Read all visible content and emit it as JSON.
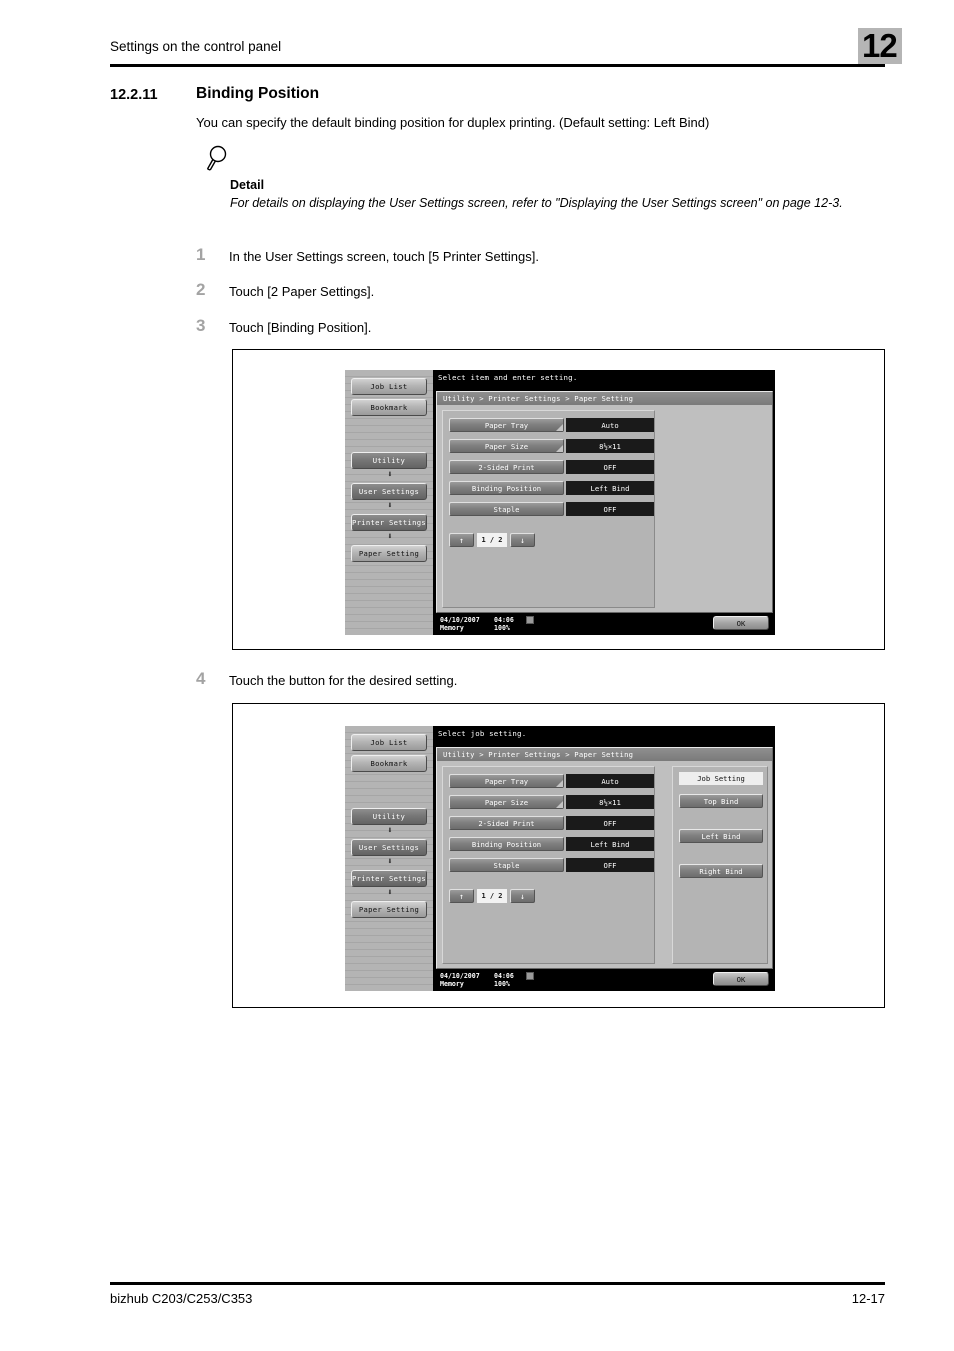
{
  "header": {
    "running_title": "Settings on the control panel",
    "chapter_number": "12"
  },
  "section": {
    "number": "12.2.11",
    "title": "Binding Position",
    "intro": "You can specify the default binding position for duplex printing. (Default setting: Left Bind)"
  },
  "detail": {
    "icon": "magnifier-icon",
    "label": "Detail",
    "text": "For details on displaying the User Settings screen, refer to \"Displaying the User Settings screen\" on page 12-3."
  },
  "steps": [
    {
      "number": "1",
      "text": "In the User Settings screen, touch [5 Printer Settings]."
    },
    {
      "number": "2",
      "text": "Touch [2 Paper Settings]."
    },
    {
      "number": "3",
      "text": "Touch [Binding Position]."
    },
    {
      "number": "4",
      "text": "Touch the button for the desired setting."
    }
  ],
  "figure1": {
    "message": "Select item and enter setting.",
    "breadcrumb": "Utility > Printer Settings > Paper Setting",
    "side_buttons": [
      {
        "label": "Job List",
        "style": "light"
      },
      {
        "label": "Bookmark",
        "style": "light"
      },
      {
        "label": "Utility",
        "style": "dark"
      },
      {
        "label": "User Settings",
        "style": "dark"
      },
      {
        "label": "Printer Settings",
        "style": "dark"
      },
      {
        "label": "Paper Setting",
        "style": "light"
      }
    ],
    "settings": [
      {
        "name": "Paper Tray",
        "value": "Auto",
        "has_corner": true
      },
      {
        "name": "Paper Size",
        "value": "8½×11",
        "has_corner": true
      },
      {
        "name": "2-Sided Print",
        "value": "OFF",
        "has_corner": false
      },
      {
        "name": "Binding Position",
        "value": "Left Bind",
        "has_corner": false
      },
      {
        "name": "Staple",
        "value": "OFF",
        "has_corner": false
      }
    ],
    "pager": {
      "up": "↑",
      "label": "1 / 2",
      "down": "↓"
    },
    "status": {
      "date": "04/10/2007",
      "time": "04:06",
      "memory_label": "Memory",
      "memory_value": "100%",
      "icon": "status-indicator-icon"
    },
    "ok_label": "OK"
  },
  "figure2": {
    "message": "Select job setting.",
    "breadcrumb": "Utility > Printer Settings > Paper Setting",
    "side_buttons": [
      {
        "label": "Job List",
        "style": "light"
      },
      {
        "label": "Bookmark",
        "style": "light"
      },
      {
        "label": "Utility",
        "style": "dark"
      },
      {
        "label": "User Settings",
        "style": "dark"
      },
      {
        "label": "Printer Settings",
        "style": "dark"
      },
      {
        "label": "Paper Setting",
        "style": "light"
      }
    ],
    "settings": [
      {
        "name": "Paper Tray",
        "value": "Auto",
        "has_corner": true
      },
      {
        "name": "Paper Size",
        "value": "8½×11",
        "has_corner": true
      },
      {
        "name": "2-Sided Print",
        "value": "OFF",
        "has_corner": false
      },
      {
        "name": "Binding Position",
        "value": "Left Bind",
        "has_corner": false
      },
      {
        "name": "Staple",
        "value": "OFF",
        "has_corner": false
      }
    ],
    "job_pane": {
      "title": "Job Setting",
      "options": [
        "Top Bind",
        "Left Bind",
        "Right Bind"
      ]
    },
    "pager": {
      "up": "↑",
      "label": "1 / 2",
      "down": "↓"
    },
    "status": {
      "date": "04/10/2007",
      "time": "04:06",
      "memory_label": "Memory",
      "memory_value": "100%",
      "icon": "status-indicator-icon"
    },
    "ok_label": "OK"
  },
  "footer": {
    "product": "bizhub C203/C253/C353",
    "page_number": "12-17"
  }
}
